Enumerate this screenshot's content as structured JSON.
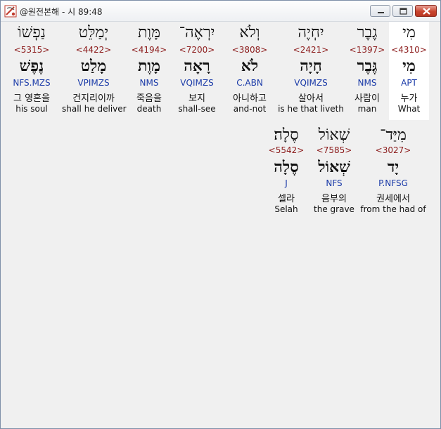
{
  "window": {
    "title": "@원전본해 - 시 89:48",
    "controls": {
      "minimize": "minimize-icon",
      "maximize": "maximize-icon",
      "close": "close-icon"
    }
  },
  "rows": [
    {
      "words": [
        {
          "hebrew": "מִי",
          "strong": "<4310>",
          "lemma": "מִי",
          "morph": "APT",
          "korean": "누가",
          "english": "What",
          "selected": true
        },
        {
          "hebrew": "גֶבֶר",
          "strong": "<1397>",
          "lemma": "גֶּבֶר",
          "morph": "NMS",
          "korean": "사람이",
          "english": "man"
        },
        {
          "hebrew": "יִחְיֶה",
          "strong": "<2421>",
          "lemma": "חָיָה",
          "morph": "VQIMZS",
          "korean": "살아서",
          "english": "is he that liveth"
        },
        {
          "hebrew": "וְלֹא",
          "strong": "<3808>",
          "lemma": "לֹא",
          "morph": "C.ABN",
          "korean": "아니하고",
          "english": "and-not"
        },
        {
          "hebrew": "יִרְאֶה־",
          "strong": "<7200>",
          "lemma": "רָאָה",
          "morph": "VQIMZS",
          "korean": "보지",
          "english": "shall-see"
        },
        {
          "hebrew": "מָּוֶת",
          "strong": "<4194>",
          "lemma": "מָוֶת",
          "morph": "NMS",
          "korean": "죽음을",
          "english": "death"
        },
        {
          "hebrew": "יְמַלֵּט",
          "strong": "<4422>",
          "lemma": "מָלַט",
          "morph": "VPIMZS",
          "korean": "건지리이까",
          "english": "shall he deliver"
        },
        {
          "hebrew": "נַפְשׁוֹ",
          "strong": "<5315>",
          "lemma": "נֶפֶשׁ",
          "morph": "NFS.MZS",
          "korean": "그 영혼을",
          "english": "his soul"
        }
      ]
    },
    {
      "words": [
        {
          "hebrew": "מִיַּד־",
          "strong": "<3027>",
          "lemma": "יָד",
          "morph": "P.NFSG",
          "korean": "권세에서",
          "english": "from the had of"
        },
        {
          "hebrew": "שְׁאוֹל",
          "strong": "<7585>",
          "lemma": "שְׁאוֹל",
          "morph": "NFS",
          "korean": "음부의",
          "english": "the grave"
        },
        {
          "hebrew": "סֶלָה׃",
          "strong": "<5542>",
          "lemma": "סֶלָה",
          "morph": "J",
          "korean": "셀라",
          "english": "Selah"
        }
      ]
    }
  ]
}
